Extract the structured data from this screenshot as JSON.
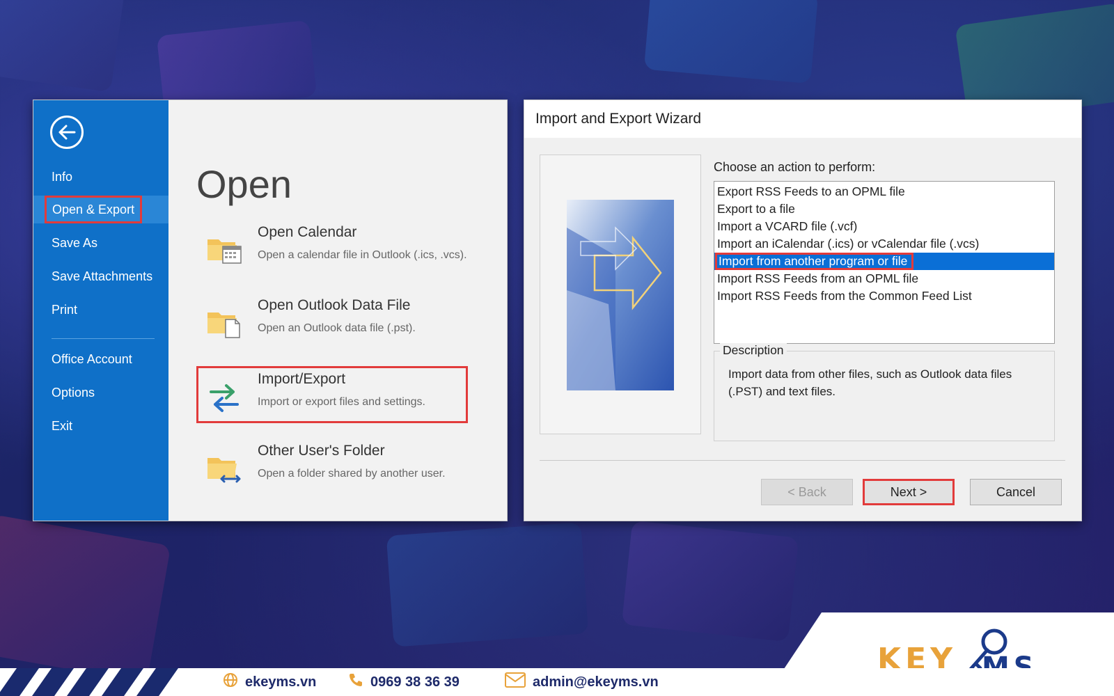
{
  "outlook": {
    "nav": {
      "items": [
        {
          "label": "Info"
        },
        {
          "label": "Open & Export"
        },
        {
          "label": "Save As"
        },
        {
          "label": "Save Attachments"
        },
        {
          "label": "Print"
        },
        {
          "label": "Office Account"
        },
        {
          "label": "Options"
        },
        {
          "label": "Exit"
        }
      ],
      "active": "Open & Export"
    },
    "page_title": "Open",
    "entries": [
      {
        "title": "Open Calendar",
        "desc": "Open a calendar file in Outlook (.ics, .vcs).",
        "icon": "folder-calendar-icon"
      },
      {
        "title": "Open Outlook Data File",
        "desc": "Open an Outlook data file (.pst).",
        "icon": "folder-file-icon"
      },
      {
        "title": "Import/Export",
        "desc": "Import or export files and settings.",
        "icon": "import-export-arrows-icon"
      },
      {
        "title": "Other User's Folder",
        "desc": "Open a folder shared by another user.",
        "icon": "folder-shared-icon"
      }
    ]
  },
  "wizard": {
    "title": "Import and Export Wizard",
    "choose_label": "Choose an action to perform:",
    "actions": [
      "Export RSS Feeds to an OPML file",
      "Export to a file",
      "Import a VCARD file (.vcf)",
      "Import an iCalendar (.ics) or vCalendar file (.vcs)",
      "Import from another program or file",
      "Import RSS Feeds from an OPML file",
      "Import RSS Feeds from the Common Feed List"
    ],
    "selected_index": 4,
    "description_label": "Description",
    "description_text": "Import data from other files, such as Outlook data files (.PST) and text files.",
    "buttons": {
      "back": "< Back",
      "next": "Next >",
      "cancel": "Cancel"
    }
  },
  "footer": {
    "website": "ekeyms.vn",
    "phone": "0969 38 36 39",
    "email": "admin@ekeyms.vn",
    "brand": "KEYMS"
  },
  "colors": {
    "accent": "#0f70c8",
    "highlight": "#e23b3b",
    "selection": "#0a6fd6"
  }
}
